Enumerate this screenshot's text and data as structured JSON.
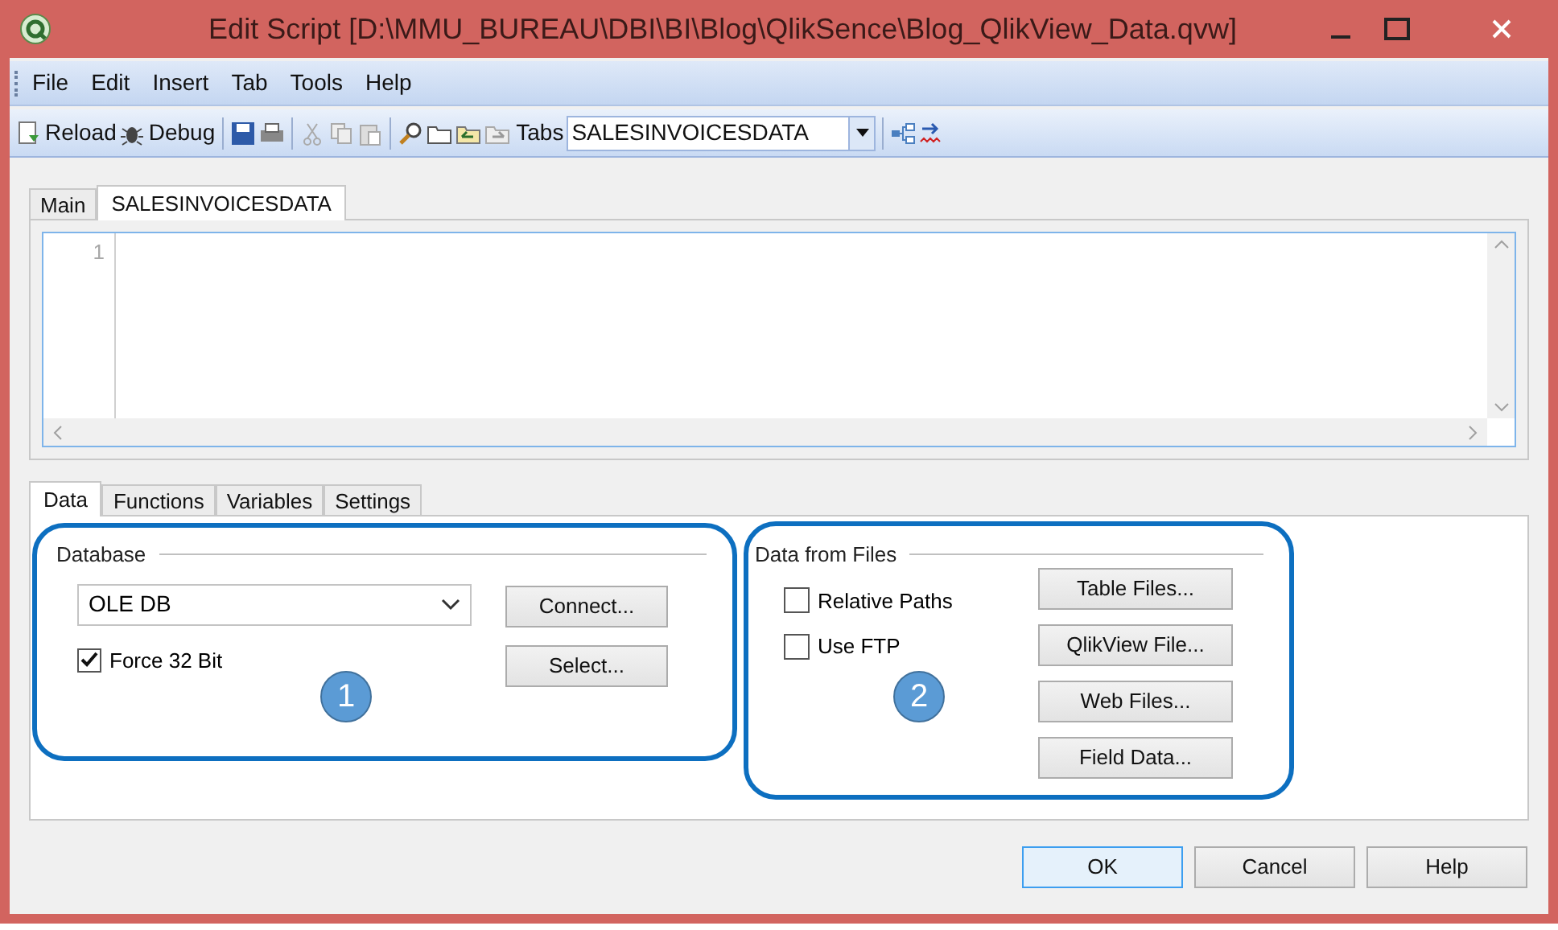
{
  "window": {
    "title": "Edit Script [D:\\MMU_BUREAU\\DBI\\BI\\Blog\\QlikSence\\Blog_QlikView_Data.qvw]"
  },
  "menu": [
    "File",
    "Edit",
    "Insert",
    "Tab",
    "Tools",
    "Help"
  ],
  "toolbar": {
    "reload": "Reload",
    "debug": "Debug",
    "tabs_label": "Tabs",
    "tab_select": "SALESINVOICESDATA"
  },
  "script_tabs": [
    {
      "label": "Main",
      "selected": false
    },
    {
      "label": "SALESINVOICESDATA",
      "selected": true
    }
  ],
  "editor": {
    "line_numbers": [
      "1"
    ]
  },
  "panel_tabs": [
    {
      "label": "Data",
      "selected": true
    },
    {
      "label": "Functions",
      "selected": false
    },
    {
      "label": "Variables",
      "selected": false
    },
    {
      "label": "Settings",
      "selected": false
    }
  ],
  "database": {
    "legend": "Database",
    "driver": "OLE DB",
    "force_32_bit": {
      "label": "Force 32 Bit",
      "checked": true
    },
    "buttons": [
      "Connect...",
      "Select..."
    ]
  },
  "data_from_files": {
    "legend": "Data from Files",
    "options": [
      {
        "label": "Relative Paths",
        "checked": false
      },
      {
        "label": "Use FTP",
        "checked": false
      }
    ],
    "buttons": [
      "Table Files...",
      "QlikView File...",
      "Web Files...",
      "Field Data..."
    ]
  },
  "callouts": [
    "1",
    "2"
  ],
  "dialog_buttons": [
    {
      "label": "OK",
      "default": true
    },
    {
      "label": "Cancel",
      "default": false
    },
    {
      "label": "Help",
      "default": false
    }
  ]
}
